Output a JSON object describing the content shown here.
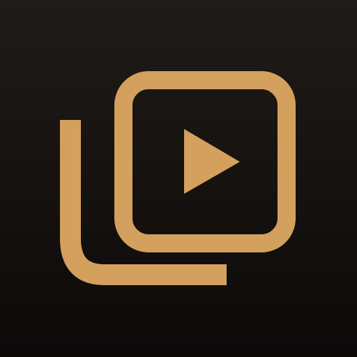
{
  "icon": {
    "name": "video-playlist-icon",
    "background_color_top": "#1f1b18",
    "background_color_bottom": "#0c0a09",
    "accent_color": "#d4a05e"
  }
}
